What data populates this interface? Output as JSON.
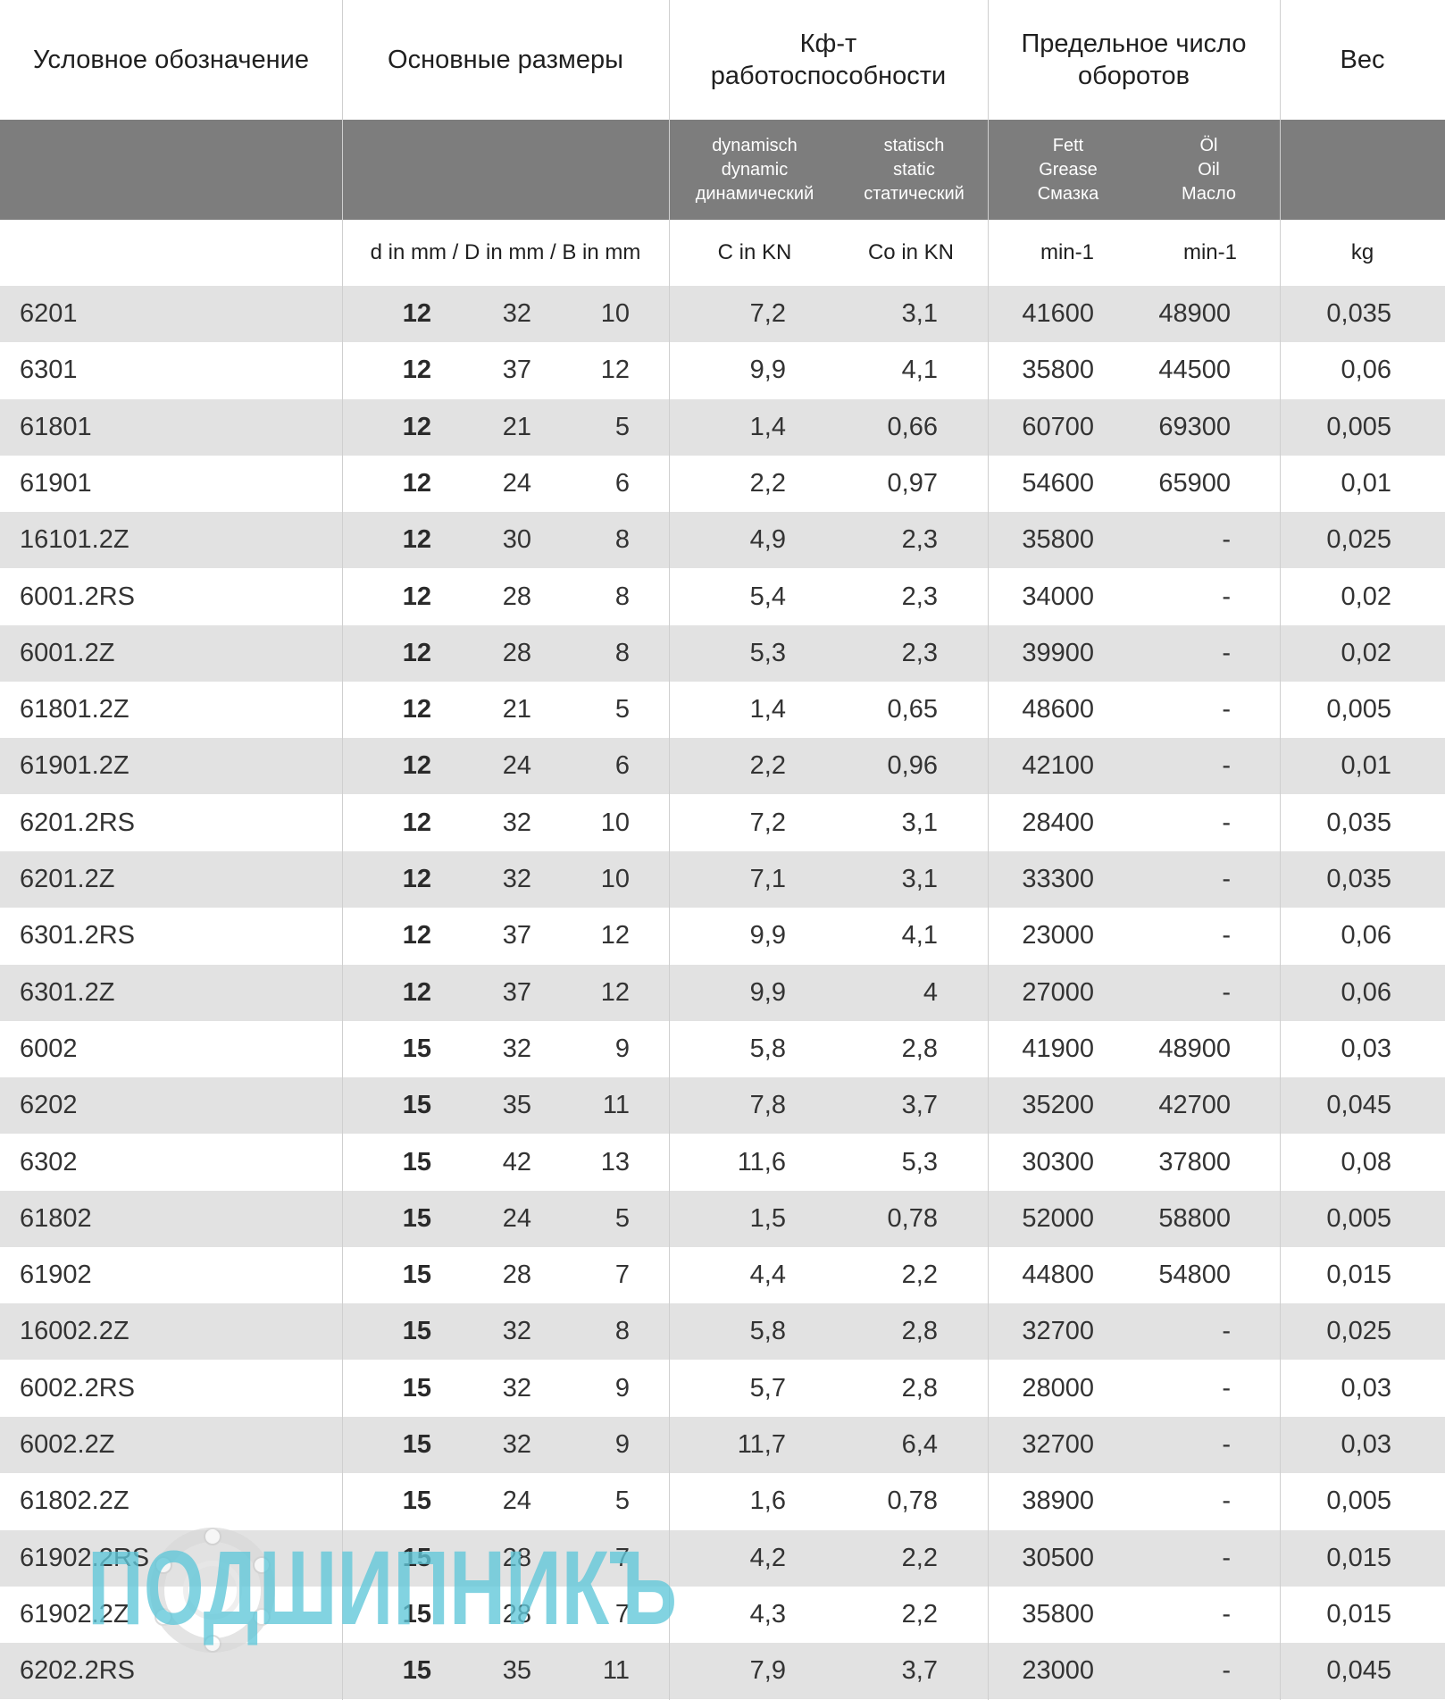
{
  "header": {
    "designation": "Условное обозначение",
    "dimensions": "Основные размеры",
    "capacity": "Кф-т\nработоспособности",
    "speed_limit": "Предельное число\nоборотов",
    "weight": "Вес"
  },
  "subheader": {
    "dynamic": "dynamisch\ndynamic\nдинамический",
    "static": "statisch\nstatic\nстатический",
    "grease": "Fett\nGrease\nСмазка",
    "oil": "Öl\nOil\nМасло"
  },
  "units": {
    "dims": "d in mm / D in mm / B in mm",
    "c": "C in KN",
    "co": "Co in KN",
    "grease": "min-1",
    "oil": "min-1",
    "weight": "kg"
  },
  "rows": [
    [
      "6201",
      "12",
      "32",
      "10",
      "7,2",
      "3,1",
      "41600",
      "48900",
      "0,035"
    ],
    [
      "6301",
      "12",
      "37",
      "12",
      "9,9",
      "4,1",
      "35800",
      "44500",
      "0,06"
    ],
    [
      "61801",
      "12",
      "21",
      "5",
      "1,4",
      "0,66",
      "60700",
      "69300",
      "0,005"
    ],
    [
      "61901",
      "12",
      "24",
      "6",
      "2,2",
      "0,97",
      "54600",
      "65900",
      "0,01"
    ],
    [
      "16101.2Z",
      "12",
      "30",
      "8",
      "4,9",
      "2,3",
      "35800",
      "-",
      "0,025"
    ],
    [
      "6001.2RS",
      "12",
      "28",
      "8",
      "5,4",
      "2,3",
      "34000",
      "-",
      "0,02"
    ],
    [
      "6001.2Z",
      "12",
      "28",
      "8",
      "5,3",
      "2,3",
      "39900",
      "-",
      "0,02"
    ],
    [
      "61801.2Z",
      "12",
      "21",
      "5",
      "1,4",
      "0,65",
      "48600",
      "-",
      "0,005"
    ],
    [
      "61901.2Z",
      "12",
      "24",
      "6",
      "2,2",
      "0,96",
      "42100",
      "-",
      "0,01"
    ],
    [
      "6201.2RS",
      "12",
      "32",
      "10",
      "7,2",
      "3,1",
      "28400",
      "-",
      "0,035"
    ],
    [
      "6201.2Z",
      "12",
      "32",
      "10",
      "7,1",
      "3,1",
      "33300",
      "-",
      "0,035"
    ],
    [
      "6301.2RS",
      "12",
      "37",
      "12",
      "9,9",
      "4,1",
      "23000",
      "-",
      "0,06"
    ],
    [
      "6301.2Z",
      "12",
      "37",
      "12",
      "9,9",
      "4",
      "27000",
      "-",
      "0,06"
    ],
    [
      "6002",
      "15",
      "32",
      "9",
      "5,8",
      "2,8",
      "41900",
      "48900",
      "0,03"
    ],
    [
      "6202",
      "15",
      "35",
      "11",
      "7,8",
      "3,7",
      "35200",
      "42700",
      "0,045"
    ],
    [
      "6302",
      "15",
      "42",
      "13",
      "11,6",
      "5,3",
      "30300",
      "37800",
      "0,08"
    ],
    [
      "61802",
      "15",
      "24",
      "5",
      "1,5",
      "0,78",
      "52000",
      "58800",
      "0,005"
    ],
    [
      "61902",
      "15",
      "28",
      "7",
      "4,4",
      "2,2",
      "44800",
      "54800",
      "0,015"
    ],
    [
      "16002.2Z",
      "15",
      "32",
      "8",
      "5,8",
      "2,8",
      "32700",
      "-",
      "0,025"
    ],
    [
      "6002.2RS",
      "15",
      "32",
      "9",
      "5,7",
      "2,8",
      "28000",
      "-",
      "0,03"
    ],
    [
      "6002.2Z",
      "15",
      "32",
      "9",
      "11,7",
      "6,4",
      "32700",
      "-",
      "0,03"
    ],
    [
      "61802.2Z",
      "15",
      "24",
      "5",
      "1,6",
      "0,78",
      "38900",
      "-",
      "0,005"
    ],
    [
      "61902.2RS",
      "15",
      "28",
      "7",
      "4,2",
      "2,2",
      "30500",
      "-",
      "0,015"
    ],
    [
      "61902.2Z",
      "15",
      "28",
      "7",
      "4,3",
      "2,2",
      "35800",
      "-",
      "0,015"
    ],
    [
      "6202.2RS",
      "15",
      "35",
      "11",
      "7,9",
      "3,7",
      "23000",
      "-",
      "0,045"
    ]
  ],
  "watermark": {
    "text": "ПОДШИПНИКЪ",
    "color": "#5fc6d9"
  }
}
